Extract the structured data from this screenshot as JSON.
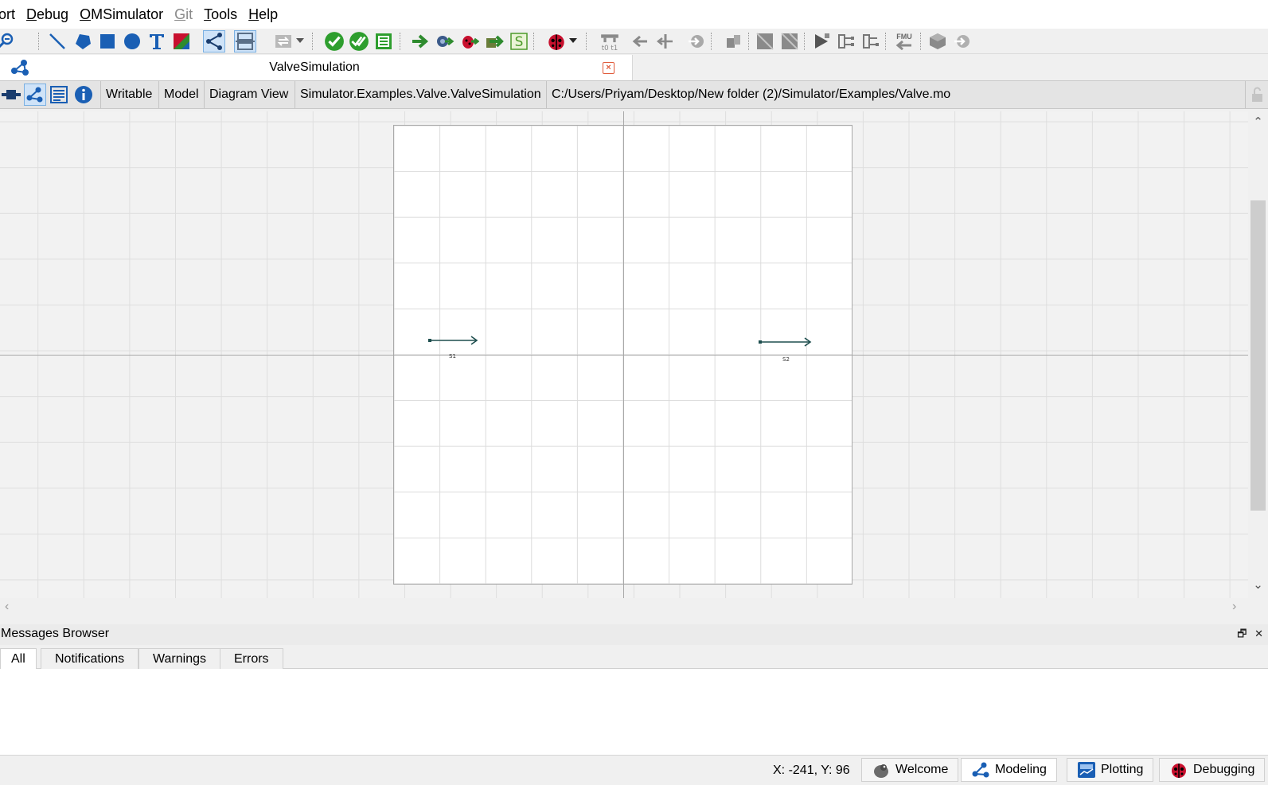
{
  "menu": {
    "items": [
      {
        "label": "ort",
        "underline": "",
        "rest": "ort",
        "disabled": false
      },
      {
        "label": "Debug",
        "underline": "D",
        "rest": "ebug",
        "disabled": false
      },
      {
        "label": "OMSimulator",
        "underline": "O",
        "rest": "MSimulator",
        "disabled": false
      },
      {
        "label": "Git",
        "underline": "G",
        "rest": "it",
        "disabled": true
      },
      {
        "label": "Tools",
        "underline": "T",
        "rest": "ools",
        "disabled": false
      },
      {
        "label": "Help",
        "underline": "H",
        "rest": "elp",
        "disabled": false
      }
    ]
  },
  "toolbar": {
    "icons": [
      "zoom-out-icon",
      "line-icon",
      "polygon-icon",
      "rectangle-icon",
      "ellipse-icon",
      "text-icon",
      "bitmap-icon",
      "connect-mode-icon",
      "transition-mode-icon",
      "swap-icon",
      "check-model-icon",
      "check-all-models-icon",
      "instantiate-model-icon",
      "simulate-icon",
      "simulate-setup-icon",
      "simulate-debug-icon",
      "simulate-animate-icon",
      "simulation-script-icon",
      "debugger-icon",
      "interactive-simulation-icon",
      "step-back-icon",
      "step-forward-icon",
      "transformational-debug-icon",
      "fmu-import-icon",
      "export-icon",
      "export-xml-icon",
      "run-icon",
      "network-icon",
      "network-alt-icon",
      "fmu-export-icon",
      "cube-icon",
      "forward-icon"
    ],
    "fmu_text": "FMU",
    "ti_text": "t0 t1"
  },
  "tab": {
    "title": "ValveSimulation",
    "close_glyph": "×"
  },
  "infobar": {
    "access": "Writable",
    "restriction": "Model",
    "view": "Diagram View",
    "class_name": "Simulator.Examples.Valve.ValveSimulation",
    "file_path": "C:/Users/Priyam/Desktop/New folder (2)/Simulator/Examples/Valve.mo"
  },
  "diagram": {
    "components": [
      {
        "name": "S1",
        "label": "S1"
      },
      {
        "name": "S2",
        "label": "S2"
      }
    ],
    "connector_color": "#1f4f4f"
  },
  "messages": {
    "title": "Messages Browser",
    "float_glyph": "🗗",
    "close_glyph": "✕",
    "tabs": [
      "All",
      "Notifications",
      "Warnings",
      "Errors"
    ],
    "selected_tab": "All"
  },
  "status": {
    "coords": "X: -241, Y: 96",
    "perspectives": [
      {
        "label": "Welcome",
        "icon": "welcome-icon"
      },
      {
        "label": "Modeling",
        "icon": "modeling-icon",
        "selected": true
      },
      {
        "label": "Plotting",
        "icon": "plotting-icon"
      },
      {
        "label": "Debugging",
        "icon": "debugging-icon"
      }
    ]
  },
  "colors": {
    "accent_blue": "#1a5fb4",
    "check_green": "#2e9e2e",
    "debug_red": "#c8102e",
    "selected_bg": "#cfe3f8"
  }
}
